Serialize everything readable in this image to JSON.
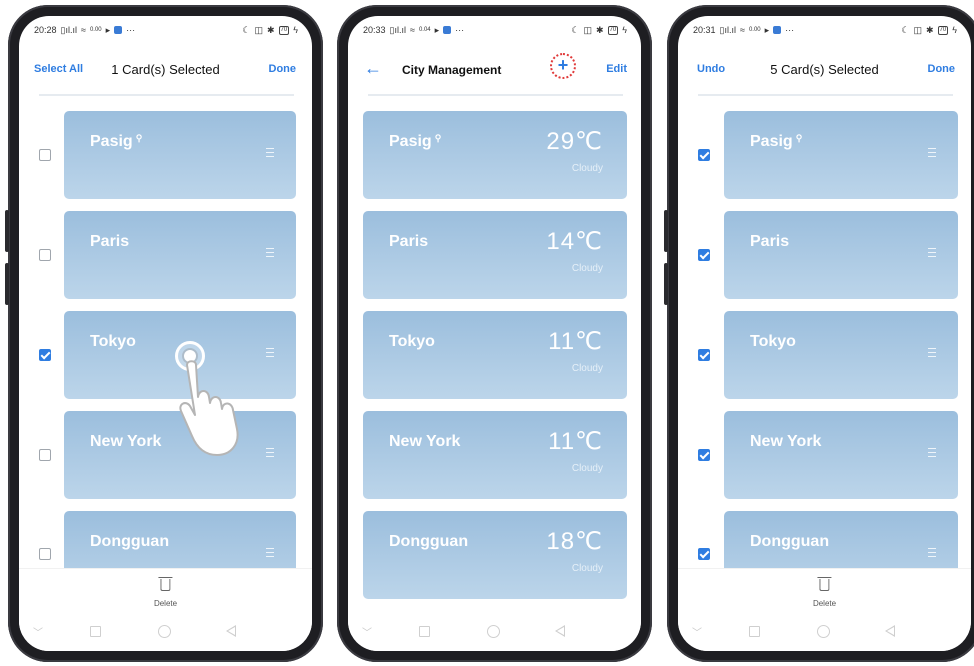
{
  "colors": {
    "accent": "#2f7de1",
    "card_top": "#9bbedd",
    "card_bottom": "#bcd5ea",
    "highlight": "#e03a3a"
  },
  "phones": [
    {
      "status": {
        "time": "20:28",
        "net": "0.00",
        "battery": "70"
      },
      "top_bar": {
        "left": "Select All",
        "center": "1 Card(s) Selected",
        "right": "Done"
      },
      "cards": [
        {
          "city": "Pasig",
          "checked": false
        },
        {
          "city": "Paris",
          "checked": false
        },
        {
          "city": "Tokyo",
          "checked": true
        },
        {
          "city": "New York",
          "checked": false
        },
        {
          "city": "Dongguan",
          "checked": false
        }
      ],
      "bottom_action": {
        "label": "Delete",
        "icon": "trash-icon"
      }
    },
    {
      "status": {
        "time": "20:33",
        "net": "0.04",
        "battery": "70"
      },
      "top_bar": {
        "back_icon": "back-arrow-icon",
        "title": "City Management",
        "add_icon": "plus-icon",
        "right": "Edit"
      },
      "cards": [
        {
          "city": "Pasig",
          "temp": "29℃",
          "condition": "Cloudy"
        },
        {
          "city": "Paris",
          "temp": "14℃",
          "condition": "Cloudy"
        },
        {
          "city": "Tokyo",
          "temp": "11℃",
          "condition": "Cloudy"
        },
        {
          "city": "New York",
          "temp": "11℃",
          "condition": "Cloudy"
        },
        {
          "city": "Dongguan",
          "temp": "18℃",
          "condition": "Cloudy"
        }
      ]
    },
    {
      "status": {
        "time": "20:31",
        "net": "0.00",
        "battery": "70"
      },
      "top_bar": {
        "left": "Undo",
        "center": "5 Card(s) Selected",
        "right": "Done"
      },
      "cards": [
        {
          "city": "Pasig",
          "checked": true
        },
        {
          "city": "Paris",
          "checked": true
        },
        {
          "city": "Tokyo",
          "checked": true
        },
        {
          "city": "New York",
          "checked": true
        },
        {
          "city": "Dongguan",
          "checked": true
        }
      ],
      "bottom_action": {
        "label": "Delete",
        "icon": "trash-icon"
      }
    }
  ]
}
